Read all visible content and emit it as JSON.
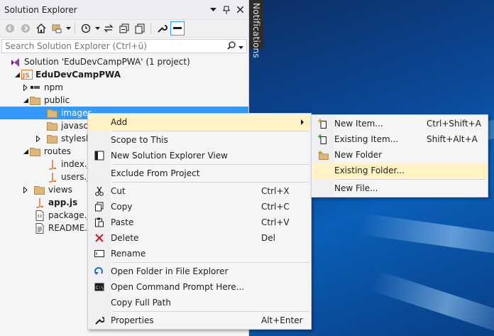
{
  "panel": {
    "title": "Solution Explorer",
    "search_placeholder": "Search Solution Explorer (Ctrl+ü)"
  },
  "notifications_label": "Notifications",
  "tree": {
    "solution": "Solution 'EduDevCampPWA' (1 project)",
    "project": "EduDevCampPWA",
    "npm": "npm",
    "public": "public",
    "images": "images",
    "javascripts": "javascripts",
    "stylesheets": "stylesheets",
    "routes": "routes",
    "index": "index.js",
    "users": "users.js",
    "views": "views",
    "app": "app.js",
    "package": "package.json",
    "readme": "README.md"
  },
  "context_menu": {
    "add": "Add",
    "scope": "Scope to This",
    "new_view": "New Solution Explorer View",
    "exclude": "Exclude From Project",
    "cut": "Cut",
    "cut_sc": "Ctrl+X",
    "copy": "Copy",
    "copy_sc": "Ctrl+C",
    "paste": "Paste",
    "paste_sc": "Ctrl+V",
    "delete": "Delete",
    "delete_sc": "Del",
    "rename": "Rename",
    "open_folder": "Open Folder in File Explorer",
    "open_cmd": "Open Command Prompt Here...",
    "copy_path": "Copy Full Path",
    "properties": "Properties",
    "properties_sc": "Alt+Enter"
  },
  "add_submenu": {
    "new_item": "New Item...",
    "new_item_sc": "Ctrl+Shift+A",
    "existing_item": "Existing Item...",
    "existing_item_sc": "Shift+Alt+A",
    "new_folder": "New Folder",
    "existing_folder": "Existing Folder...",
    "new_file": "New File..."
  },
  "colors": {
    "selection": "#3399ff",
    "menu_highlight": "#fff2c5",
    "folder": "#dcb67a",
    "js": "#e37933"
  }
}
